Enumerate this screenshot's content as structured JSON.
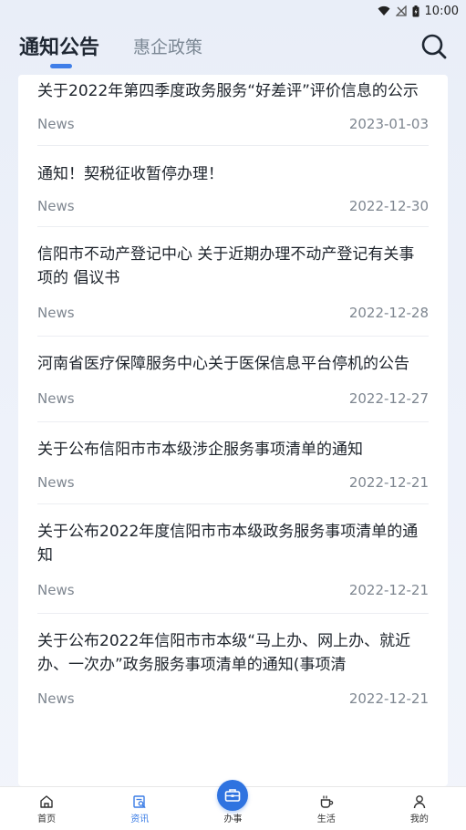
{
  "status_bar": {
    "time": "10:00"
  },
  "header": {
    "tabs": [
      {
        "label": "通知公告"
      },
      {
        "label": "惠企政策"
      }
    ]
  },
  "news": [
    {
      "title": "关于2022年第四季度政务服务“好差评”评价信息的公示",
      "tag": "News",
      "date": "2023-01-03"
    },
    {
      "title": "通知！契税征收暂停办理！",
      "tag": "News",
      "date": "2022-12-30"
    },
    {
      "title": "信阳市不动产登记中心 关于近期办理不动产登记有关事项的 倡议书",
      "tag": "News",
      "date": "2022-12-28"
    },
    {
      "title": "河南省医疗保障服务中心关于医保信息平台停机的公告",
      "tag": "News",
      "date": "2022-12-27"
    },
    {
      "title": "关于公布信阳市市本级涉企服务事项清单的通知",
      "tag": "News",
      "date": "2022-12-21"
    },
    {
      "title": "关于公布2022年度信阳市市本级政务服务事项清单的通知",
      "tag": "News",
      "date": "2022-12-21"
    },
    {
      "title": "关于公布2022年信阳市市本级“马上办、网上办、就近办、一次办”政务服务事项清单的通知(事项清",
      "tag": "News",
      "date": "2022-12-21"
    }
  ],
  "bottom_nav": [
    {
      "label": "首页",
      "icon": "home-icon"
    },
    {
      "label": "资讯",
      "icon": "news-icon"
    },
    {
      "label": "办事",
      "icon": "briefcase-icon"
    },
    {
      "label": "生活",
      "icon": "coffee-icon"
    },
    {
      "label": "我的",
      "icon": "user-icon"
    }
  ],
  "colors": {
    "accent": "#3b7de6",
    "fab": "#2f73e0"
  }
}
